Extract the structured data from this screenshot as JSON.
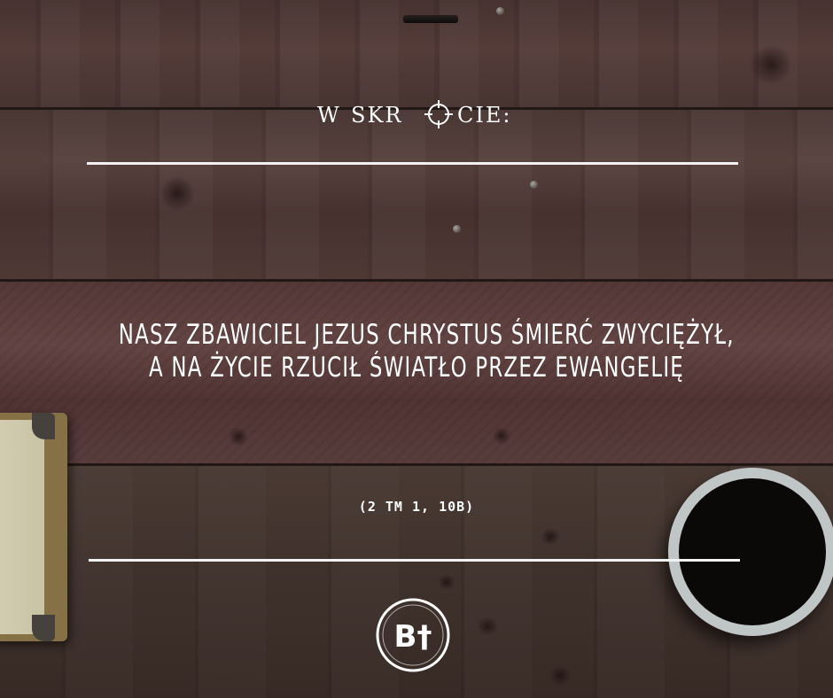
{
  "header": {
    "w": "W",
    "skr": "SKR",
    "cie": "CIE:",
    "o_icon": "crosshair-icon"
  },
  "quote": {
    "line1": "NASZ ZBAWICIEL JEZUS CHRYSTUS ŚMIERĆ ZWYCIĘŻYŁ,",
    "line2": "A NA ŻYCIE RZUCIŁ ŚWIATŁO PRZEZ EWANGELIĘ"
  },
  "reference": "(2 TM 1, 10B)",
  "logo": {
    "icon": "bt-logo-icon",
    "text": "B†"
  },
  "colors": {
    "text": "#ffffff",
    "rules": "#f2f2f2",
    "wood_dark": "#3b2d28",
    "wood_red": "#6a4a49"
  }
}
